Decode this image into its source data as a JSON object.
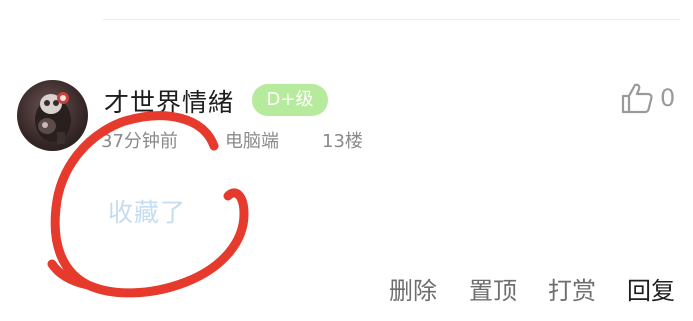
{
  "comment": {
    "username": "才世界情緒",
    "level_badge": "D+级",
    "time": "37分钟前",
    "device": "电脑端",
    "floor": "13楼",
    "content": "收藏了",
    "like_count": "0"
  },
  "actions": {
    "delete": "删除",
    "pin": "置顶",
    "reward": "打赏",
    "reply": "回复"
  },
  "icons": {
    "like": "thumbs-up-icon"
  },
  "colors": {
    "badge_bg": "#b6ea9c",
    "content_text": "#c5ddf1",
    "annotation": "#e53a2c"
  }
}
